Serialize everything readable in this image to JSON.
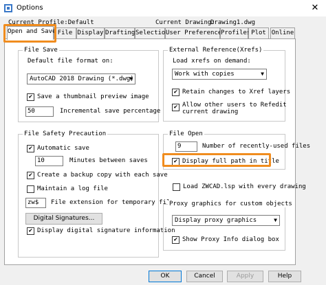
{
  "window": {
    "title": "Options",
    "close_glyph": "✕"
  },
  "profile": {
    "current_profile": "Current Profile:Default",
    "current_drawing_label": "Current Drawing:",
    "current_drawing": "Drawing1.dwg"
  },
  "tabs": [
    {
      "label": "Open and Save"
    },
    {
      "label": "File"
    },
    {
      "label": "Display"
    },
    {
      "label": "Drafting"
    },
    {
      "label": "Selection"
    },
    {
      "label": "User Preferences"
    },
    {
      "label": "Profiles"
    },
    {
      "label": "Plot"
    },
    {
      "label": "Online"
    }
  ],
  "file_save": {
    "title": "File Save",
    "format_label": "Default file format on:",
    "format_value": "AutoCAD 2018 Drawing (*.dwg)",
    "thumbnail_label": "Save a thumbnail preview image",
    "thumbnail_checked": true,
    "incremental_value": "50",
    "incremental_label": "Incremental save percentage"
  },
  "xref": {
    "title": "External Reference(Xrefs)",
    "load_label_1": "Load xrefs on demand:",
    "load_value": "Work with copies",
    "retain_label": "Retain changes to Xref layers",
    "retain_checked": true,
    "allow_label_1": "Allow other users to Refedit",
    "allow_label_2": "current drawing",
    "allow_checked": true
  },
  "file_safety": {
    "title": "File Safety Precaution",
    "autosave_label": "Automatic save",
    "autosave_checked": true,
    "minutes_value": "10",
    "minutes_label": "Minutes between saves",
    "backup_label": "Create a backup copy with each save",
    "backup_checked": true,
    "log_label": "Maintain a log file",
    "log_checked": false,
    "ext_value": "zw$",
    "ext_label": "File extension for temporary files",
    "digsig_button": "Digital Signatures...",
    "display_sig_label": "Display digital signature information",
    "display_sig_checked": true
  },
  "file_open": {
    "title": "File Open",
    "recent_value": "9",
    "recent_label": "Number of recently-used files",
    "fullpath_label": "Display full path in title",
    "fullpath_checked": true
  },
  "load_lsp": {
    "label": "Load ZWCAD.lsp with every drawing",
    "checked": false
  },
  "proxy": {
    "title": "Proxy graphics for custom objects",
    "value": "Display proxy graphics",
    "show_info_label": "Show Proxy Info dialog box",
    "show_info_checked": true
  },
  "buttons": {
    "ok": "OK",
    "cancel": "Cancel",
    "apply": "Apply",
    "help": "Help"
  },
  "glyphs": {
    "check": "✔",
    "arrow": "▼"
  },
  "colors": {
    "highlight": "#f08c1e",
    "accent": "#0078d7"
  }
}
